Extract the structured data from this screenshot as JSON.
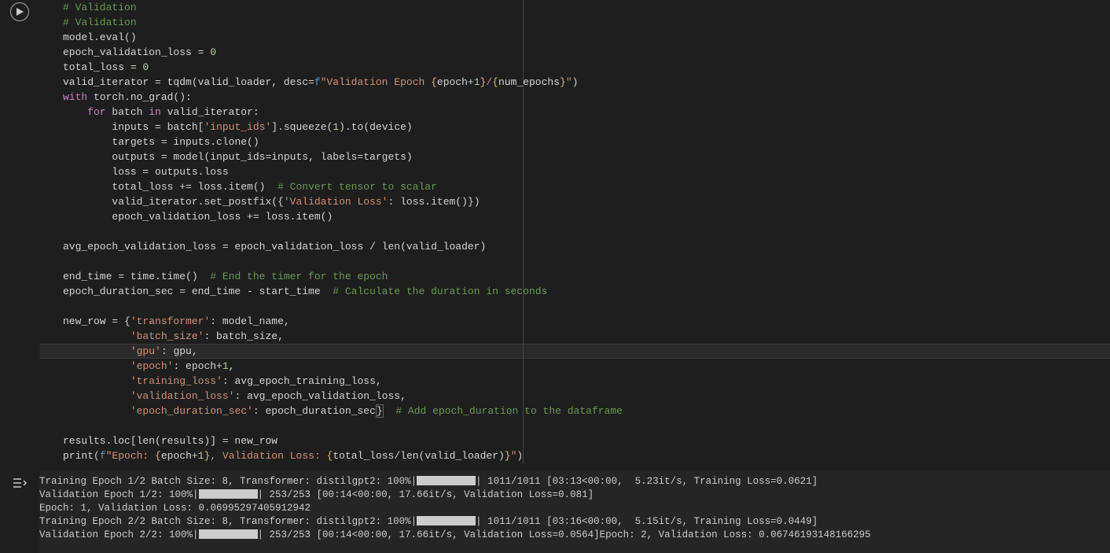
{
  "code": {
    "l1": "# Validation",
    "l2": "# Validation",
    "l3a": "model.eval",
    "l3b": "()",
    "l4": "epoch_validation_loss = ",
    "l4n": "0",
    "l5": "total_loss = ",
    "l5n": "0",
    "l6a": "valid_iterator = tqdm(valid_loader, desc=",
    "l6f": "f",
    "l6s1": "\"Validation Epoch ",
    "l6b1": "{",
    "l6e1": "epoch+",
    "l6n1": "1",
    "l6b2": "}",
    "l6s2": "/",
    "l6b3": "{",
    "l6e2": "num_epochs",
    "l6b4": "}",
    "l6s3": "\"",
    "l6z": ")",
    "l7a": "with",
    "l7b": " torch.no_grad():",
    "l8a": "for",
    "l8b": " batch ",
    "l8c": "in",
    "l8d": " valid_iterator:",
    "l9a": "inputs = batch[",
    "l9s": "'input_ids'",
    "l9b": "].squeeze(",
    "l9n": "1",
    "l9c": ").to(device)",
    "l10": "targets = inputs.clone()",
    "l11": "outputs = model(input_ids=inputs, labels=targets)",
    "l12": "loss = outputs.loss",
    "l13a": "total_loss += loss.item()  ",
    "l13c": "# Convert tensor to scalar",
    "l14a": "valid_iterator.set_postfix({",
    "l14s": "'Validation Loss'",
    "l14b": ": loss.item()",
    "l14c": "})",
    "l15": "epoch_validation_loss += loss.item()",
    "l16": "avg_epoch_validation_loss = epoch_validation_loss / len(valid_loader)",
    "l17a": "end_time = time.time()  ",
    "l17c": "# End the timer for the epoch",
    "l18a": "epoch_duration_sec = end_time - start_time  ",
    "l18c": "# Calculate the duration in seconds",
    "l19a": "new_row = {",
    "l19s": "'transformer'",
    "l19b": ": model_name,",
    "l20s": "'batch_size'",
    "l20b": ": batch_size,",
    "l21s": "'gpu'",
    "l21b": ": gpu,",
    "l22s": "'epoch'",
    "l22b": ": epoch+",
    "l22n": "1",
    "l22c": ",",
    "l23s": "'training_loss'",
    "l23b": ": avg_epoch_training_loss,",
    "l24s": "'validation_loss'",
    "l24b": ": avg_epoch_validation_loss,",
    "l25s": "'epoch_duration_sec'",
    "l25b": ": epoch_duration_sec",
    "l25z": "}",
    "l25sp": "  ",
    "l25c": "# Add epoch_duration to the dataframe",
    "l26": "results.loc[len(results)] = new_row",
    "l27a": "print(",
    "l27f": "f",
    "l27s1": "\"Epoch: ",
    "l27b1": "{",
    "l27e1": "epoch+",
    "l27n1": "1",
    "l27b2": "}",
    "l27s2": ", Validation Loss: ",
    "l27b3": "{",
    "l27e2": "total_loss/len(valid_loader)",
    "l27b4": "}",
    "l27s3": "\"",
    "l27z": ")"
  },
  "output": {
    "l1a": "Training Epoch 1/2 Batch Size: 8, Transformer: distilgpt2: 100%|",
    "l1b": "| 1011/1011 [03:13<00:00,  5.23it/s, Training Loss=0.0621]",
    "l2a": "Validation Epoch 1/2: 100%|",
    "l2b": "| 253/253 [00:14<00:00, 17.66it/s, Validation Loss=0.081]",
    "l3": "Epoch: 1, Validation Loss: 0.06995297405912942",
    "l4a": "Training Epoch 2/2 Batch Size: 8, Transformer: distilgpt2: 100%|",
    "l4b": "| 1011/1011 [03:16<00:00,  5.15it/s, Training Loss=0.0449]",
    "l5a": "Validation Epoch 2/2: 100%|",
    "l5b": "| 253/253 [00:14<00:00, 17.66it/s, Validation Loss=0.0564]Epoch: 2, Validation Loss: 0.06746193148166295"
  }
}
